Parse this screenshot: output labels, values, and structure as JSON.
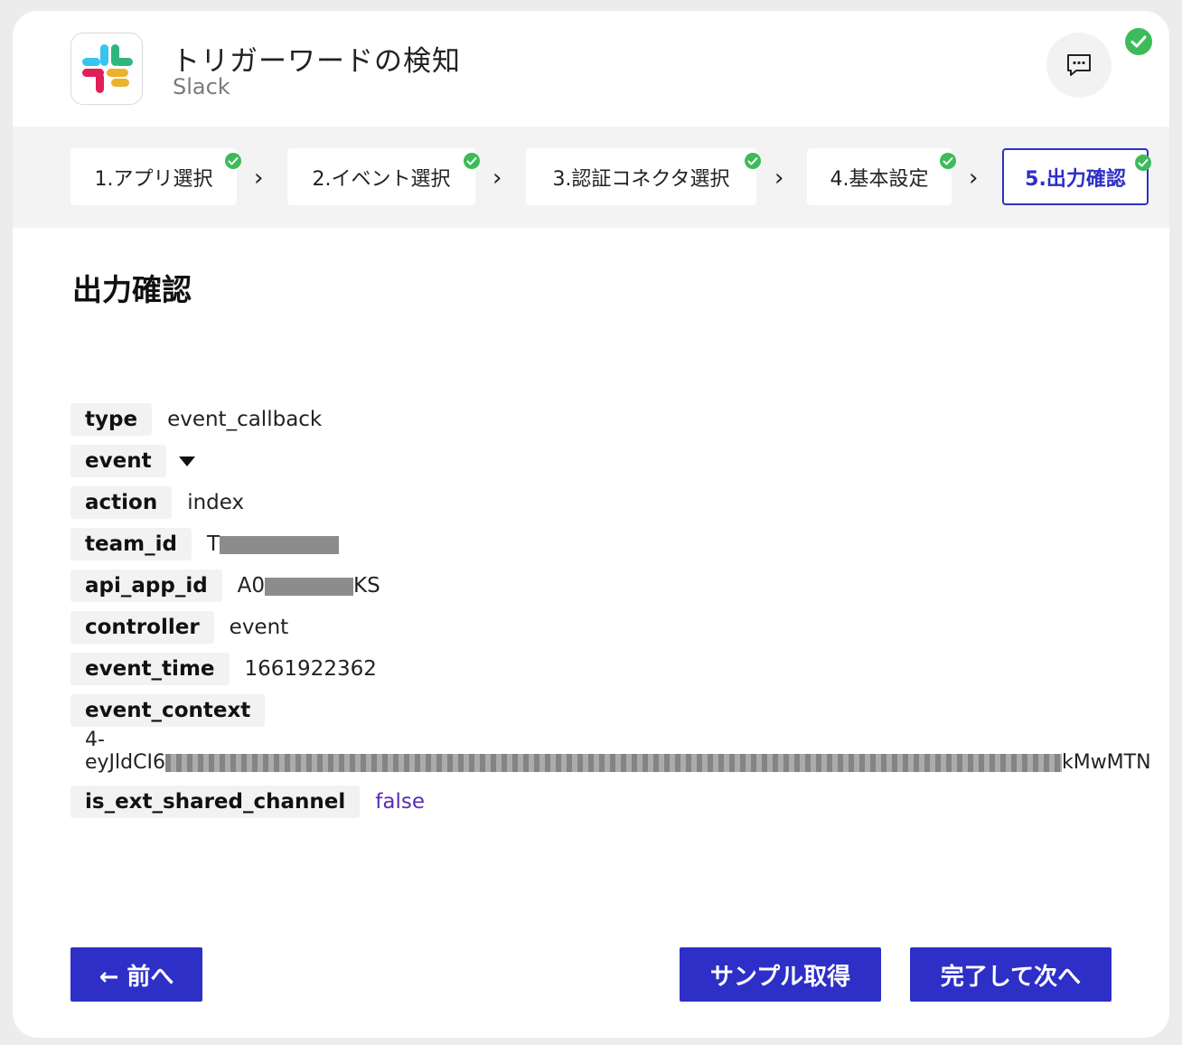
{
  "header": {
    "title": "トリガーワードの検知",
    "subtitle": "Slack",
    "app_icon": "slack-logo-icon",
    "chat_icon": "chat-bubble-icon",
    "status_icon": "check-circle-icon"
  },
  "steps": [
    {
      "label": "1.アプリ選択",
      "completed": true
    },
    {
      "label": "2.イベント選択",
      "completed": true
    },
    {
      "label": "3.認証コネクタ選択",
      "completed": true
    },
    {
      "label": "4.基本設定",
      "completed": true
    },
    {
      "label": "5.出力確認",
      "completed": true,
      "active": true
    }
  ],
  "section_title": "出力確認",
  "fields": {
    "type": {
      "key": "type",
      "value": "event_callback"
    },
    "event": {
      "key": "event",
      "collapsed": true
    },
    "action": {
      "key": "action",
      "value": "index"
    },
    "team_id": {
      "key": "team_id",
      "value_prefix": "T"
    },
    "api_app_id": {
      "key": "api_app_id",
      "value_prefix": "A0",
      "value_suffix": "KS"
    },
    "controller": {
      "key": "controller",
      "value": "event"
    },
    "event_time": {
      "key": "event_time",
      "value": "1661922362"
    },
    "event_context": {
      "key": "event_context",
      "line1": "4-",
      "value_prefix": "eyJldCI6",
      "value_suffix": "kMwMTN"
    },
    "is_ext_shared_channel": {
      "key": "is_ext_shared_channel",
      "value": "false"
    }
  },
  "buttons": {
    "prev": "← 前へ",
    "sample": "サンプル取得",
    "next": "完了して次へ"
  },
  "colors": {
    "accent": "#2d2fc7",
    "success": "#3dbb5a",
    "boolean": "#5a2bb8"
  }
}
